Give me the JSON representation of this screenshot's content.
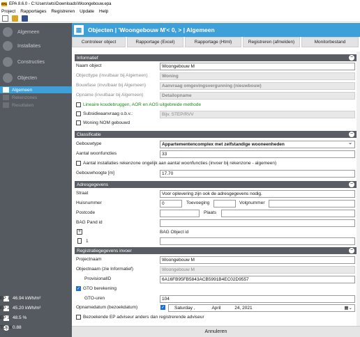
{
  "window": {
    "title": "EPA 8.6.0 - C:\\Users\\wts\\Downloads\\Woongebouw.epa"
  },
  "menu": [
    "Project",
    "Rapportages",
    "Registreren",
    "Update",
    "Help"
  ],
  "sidebar": {
    "items": [
      {
        "label": "Algemeen"
      },
      {
        "label": "Installaties"
      },
      {
        "label": "Constructies"
      },
      {
        "label": "Objecten"
      }
    ],
    "subitems": [
      {
        "label": "Algemeen"
      },
      {
        "label": "Rekenzones"
      },
      {
        "label": "Resultaten"
      }
    ]
  },
  "results": [
    {
      "label": "EP 1",
      "value": "46.94 kWh/m²"
    },
    {
      "label": "EP 2",
      "value": "45.20 kWh/m²"
    },
    {
      "label": "EP 3",
      "value": "48.5 %"
    },
    {
      "label": "TOjuli",
      "value": "0.88"
    }
  ],
  "header": {
    "title": "Objecten | 'Woongebouw M'< 0,  > | Algemeen"
  },
  "tabs": [
    "Controleer object",
    "Rapportage (Excel)",
    "Rapportage (Html)",
    "Registreren (afmelden)",
    "Monitorbestand"
  ],
  "informatief": {
    "title": "Informatief",
    "naam_label": "Naam object",
    "naam_value": "Woongebouw M",
    "objecttype_label": "Objecttype (invulbaar bij Algemeen)",
    "objecttype_value": "Woning",
    "bouwfase_label": "Bouwfase (invulbaar bij Algemeen)",
    "bouwfase_value": "Aanvraag omgevingsvergunning (nieuwbouw)",
    "opname_label": "Opname (invulbaar bij Algemeen)",
    "opname_value": "Detailopname",
    "lineaire_label": "Lineaire koudebruggen, AOR en AOS uitgebreide methode",
    "subsidie_label": "Subsidieaanvraag o.b.v.:",
    "subsidie_placeholder": "Bijv. STEP/RVV",
    "nom_label": "Woning NOM gebouwd"
  },
  "classificatie": {
    "title": "Classificatie",
    "gebouwtype_label": "Gebouwtype",
    "gebouwtype_value": "Appartementencomplex met zelfstandige wooneenheden",
    "aantal_label": "Aantal woonfuncties",
    "aantal_value": "33",
    "installaties_label": "Aantal installaties rekenzone ongelijk aan aantal woonfuncties (invoer bij rekenzone - algemeen)",
    "hoogte_label": "Gebouwhoogte [m]",
    "hoogte_value": "17.70"
  },
  "adres": {
    "title": "Adresgegevens",
    "straat_label": "Straat",
    "straat_value": "Voor oplevering zijn ook de adresgegevens nodig.",
    "huisnummer_label": "Huisnummer",
    "huisnummer_value": "0",
    "toevoeging_label": "Toevoeging",
    "volgnummer_label": "Volgnummer",
    "postcode_label": "Postcode",
    "plaats_label": "Plaats",
    "bagpand_label": "BAG Pand id",
    "bagobject_label": "BAG Object id",
    "row_number": "1"
  },
  "registratie": {
    "title": "Registratiegegevens invoer",
    "projectnaam_label": "Projectnaam",
    "projectnaam_value": "Woongebouw M",
    "objectnaam_label": "Objectnaam (zie Informatief)",
    "objectnaam_value": "Woongebouw M",
    "provisional_label": "ProvisionalID",
    "provisional_value": "6A16FB95FB5843ACB5991B4EC02D9557",
    "gto_label": "GTO berekening",
    "gtouren_label": "GTO-uren",
    "gtouren_value": "104",
    "opnamedatum_label": "Opnamedatum (bezoekdatum)",
    "date_day": "Saturday",
    "date_month": "April",
    "date_num": "24",
    "date_year": "2021",
    "bezoekende_label": "Bezoekende EP adviseur anders dan registrerende adviseur"
  },
  "footer": {
    "cancel_label": "Annuleren"
  }
}
